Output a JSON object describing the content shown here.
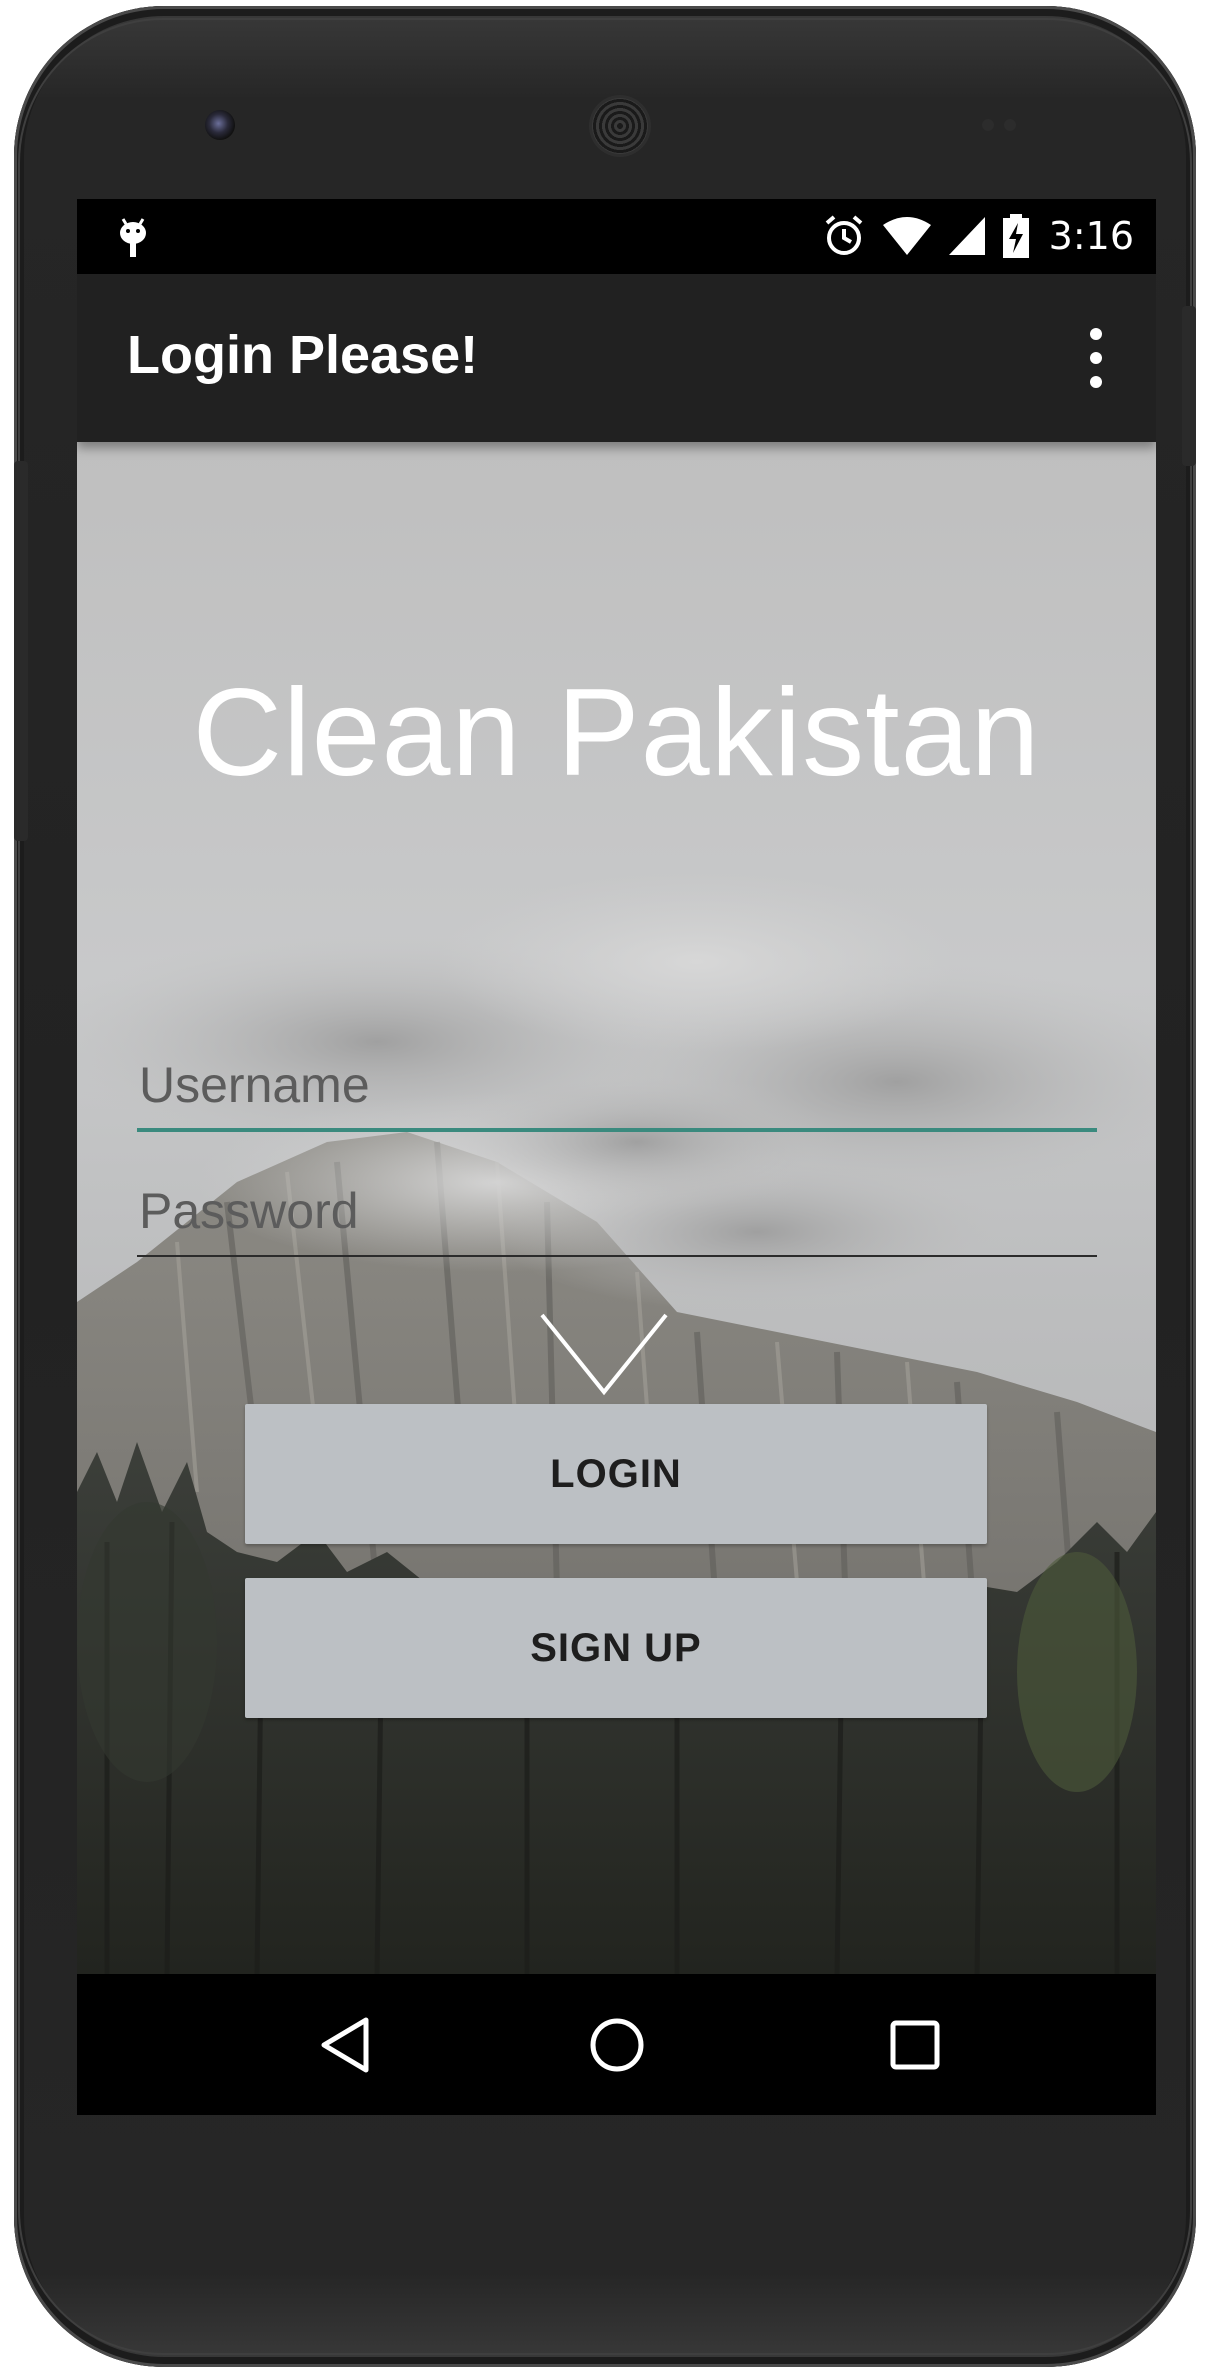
{
  "status_bar": {
    "time": "3:16",
    "notification_icon": "android-icon",
    "icons": [
      "alarm-icon",
      "wifi-icon",
      "signal-icon",
      "battery-charging-icon"
    ]
  },
  "app_bar": {
    "title": "Login Please!",
    "overflow_icon": "more-vert-icon"
  },
  "main": {
    "heading": "Clean Pakistan",
    "username": {
      "value": "",
      "placeholder": "Username"
    },
    "password": {
      "value": "",
      "placeholder": "Password"
    },
    "login_label": "LOGIN",
    "signup_label": "SIGN UP"
  },
  "nav_bar": {
    "icons": [
      "back-icon",
      "home-icon",
      "recents-icon"
    ]
  },
  "colors": {
    "app_bar": "#212121",
    "status_bar": "#000000",
    "field_focus_underline": "#3a8a7e",
    "button_background": "#bcc0c4",
    "button_text": "#1e1e1e",
    "heading_text": "#ffffff"
  }
}
